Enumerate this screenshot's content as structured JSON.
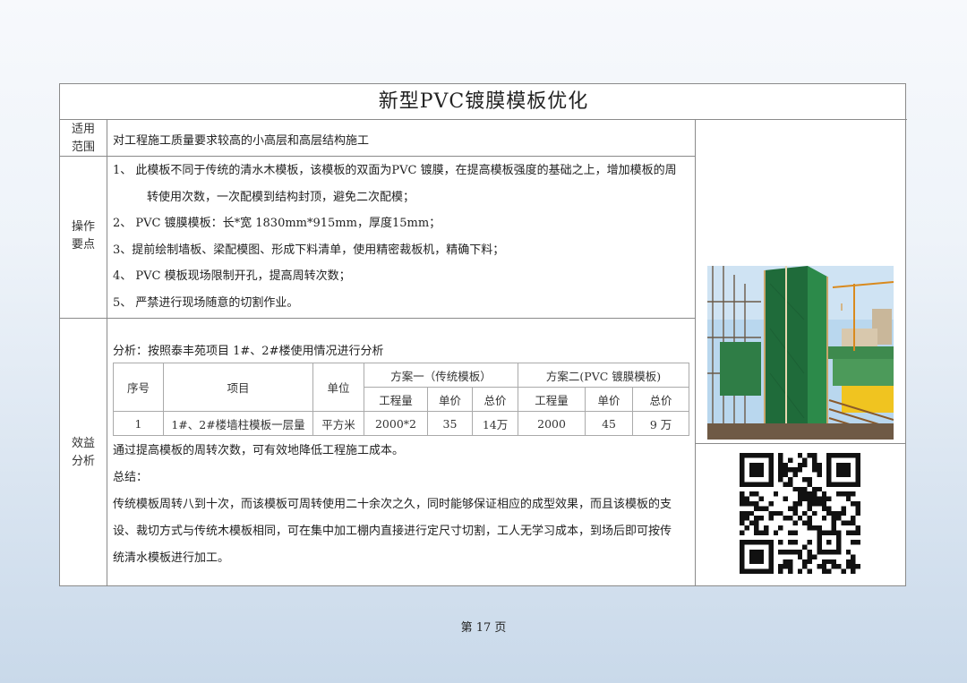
{
  "title": "新型PVC镀膜模板优化",
  "rows": {
    "scope": {
      "label": "适用范围",
      "label_lines": [
        "适用",
        "范围"
      ],
      "text": "对工程施工质量要求较高的小高层和高层结构施工"
    },
    "operation": {
      "label_lines": [
        "操作",
        "要点"
      ],
      "lines": [
        "1、 此模板不同于传统的清水木模板，该模板的双面为PVC 镀膜，在提高模板强度的基础之上，增加模板的周",
        "转使用次数，一次配模到结构封顶，避免二次配模；",
        "2、 PVC 镀膜模板：长*宽 1830mm*915mm，厚度15mm；",
        "3、提前绘制墙板、梁配模图、形成下料清单，使用精密裁板机，精确下料；",
        "4、 PVC 模板现场限制开孔，提高周转次数；",
        "5、 严禁进行现场随意的切割作业。"
      ]
    },
    "benefit": {
      "label_lines": [
        "效益",
        "分析"
      ],
      "intro": "分析：按照泰丰苑项目 1#、2#楼使用情况进行分析",
      "table": {
        "headers": {
          "no": "序号",
          "item": "项目",
          "unit": "单位",
          "plan1": "方案一（传统模板）",
          "plan2": "方案二(PVC 镀膜模板)",
          "sub": [
            "工程量",
            "单价",
            "总价",
            "工程量",
            "单价",
            "总价"
          ]
        },
        "rows": [
          [
            "1",
            "1#、2#楼墙柱模板一层量",
            "平方米",
            "2000*2",
            "35",
            "14万",
            "2000",
            "45",
            "9 万"
          ]
        ]
      },
      "after_table": "通过提高模板的周转次数，可有效地降低工程施工成本。",
      "summary_label": "总结：",
      "summary_lines": [
        "传统模板周转八到十次，而该模板可周转使用二十余次之久，同时能够保证相应的成型效果，而且该模板的支",
        "设、裁切方式与传统木模板相同，可在集中加工棚内直接进行定尺寸切割，工人无学习成本，到场后即可按传",
        "统清水模板进行加工。"
      ]
    }
  },
  "page_number": "第 17 页",
  "colors": {
    "border": "#8a8a8a",
    "formwork_green": "#1f6b3a",
    "sky": "#b9d7ee",
    "qr": "#111111"
  },
  "icons": {
    "photo": "construction-site-photo",
    "qr": "qr-code"
  }
}
